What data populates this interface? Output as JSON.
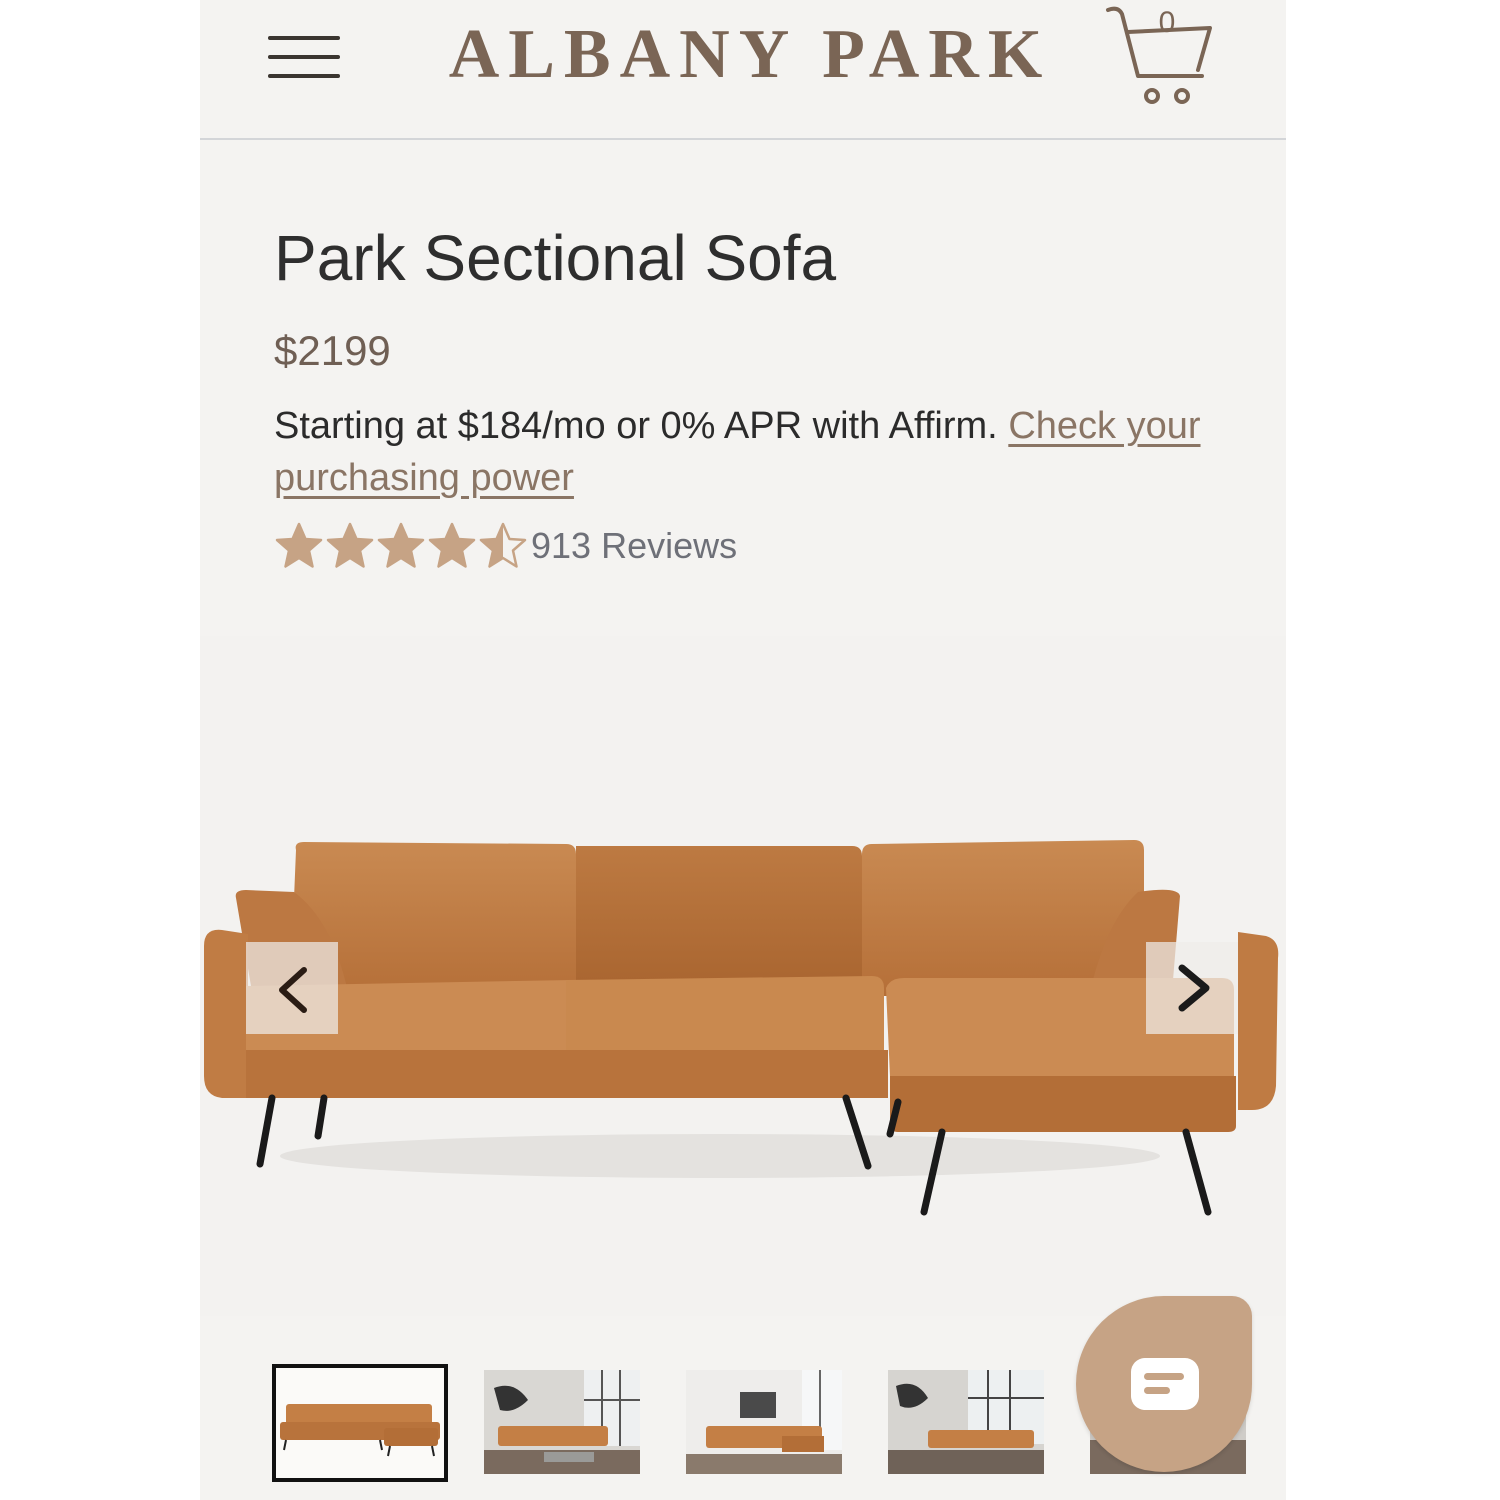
{
  "header": {
    "logo": "ALBANY PARK",
    "menu_icon": "hamburger-menu-icon",
    "cart_icon": "shopping-cart-icon",
    "cart_count": "0"
  },
  "product": {
    "title": "Park Sectional Sofa",
    "price": "$2199",
    "financing_text": "Starting at $184/mo or 0% APR with Affirm. ",
    "financing_link": "Check your purchasing power",
    "rating": 4.5,
    "rating_max": 5,
    "reviews_label": "913 Reviews"
  },
  "carousel": {
    "prev_icon": "chevron-left-icon",
    "next_icon": "chevron-right-icon",
    "active_index": 0,
    "thumbnail_count": 5
  },
  "colors": {
    "brand": "#7a6555",
    "star": "#c6a385",
    "chat_button": "#c6a385",
    "sofa_leather": "#c47f45",
    "page_background": "#f4f3f1"
  },
  "chat": {
    "icon": "chat-bubble-icon"
  }
}
